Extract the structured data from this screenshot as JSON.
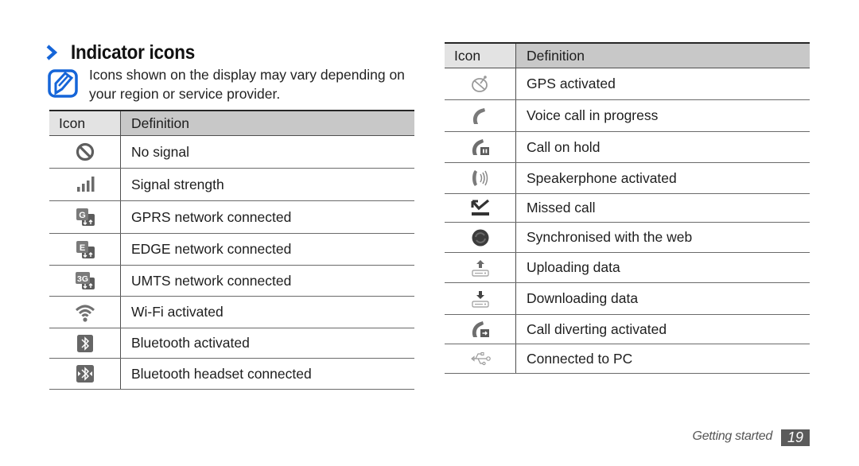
{
  "page": {
    "section_title": "Indicator icons",
    "note_icon": "note-pencil-icon",
    "note_text": "Icons shown on the display may vary depending on your region or service provider.",
    "accent_color": "#1565d8"
  },
  "left_table": {
    "headers": {
      "icon": "Icon",
      "definition": "Definition"
    },
    "rows": [
      {
        "icon": "no-signal-icon",
        "definition": "No signal"
      },
      {
        "icon": "signal-strength-icon",
        "definition": "Signal strength"
      },
      {
        "icon": "gprs-icon",
        "definition": "GPRS network connected"
      },
      {
        "icon": "edge-icon",
        "definition": "EDGE network connected"
      },
      {
        "icon": "umts-3g-icon",
        "definition": "UMTS network connected"
      },
      {
        "icon": "wifi-icon",
        "definition": "Wi-Fi activated"
      },
      {
        "icon": "bluetooth-icon",
        "definition": "Bluetooth activated"
      },
      {
        "icon": "bluetooth-headset-icon",
        "definition": "Bluetooth headset connected"
      }
    ]
  },
  "right_table": {
    "headers": {
      "icon": "Icon",
      "definition": "Definition"
    },
    "rows": [
      {
        "icon": "gps-icon",
        "definition": "GPS activated"
      },
      {
        "icon": "voice-call-icon",
        "definition": "Voice call in progress"
      },
      {
        "icon": "call-hold-icon",
        "definition": "Call on hold"
      },
      {
        "icon": "speakerphone-icon",
        "definition": "Speakerphone activated"
      },
      {
        "icon": "missed-call-icon",
        "definition": "Missed call"
      },
      {
        "icon": "sync-icon",
        "definition": "Synchronised with the web"
      },
      {
        "icon": "upload-icon",
        "definition": "Uploading data"
      },
      {
        "icon": "download-icon",
        "definition": "Downloading data"
      },
      {
        "icon": "call-divert-icon",
        "definition": "Call diverting activated"
      },
      {
        "icon": "usb-pc-icon",
        "definition": "Connected to PC"
      }
    ]
  },
  "footer": {
    "section": "Getting started",
    "page_number": "19"
  }
}
